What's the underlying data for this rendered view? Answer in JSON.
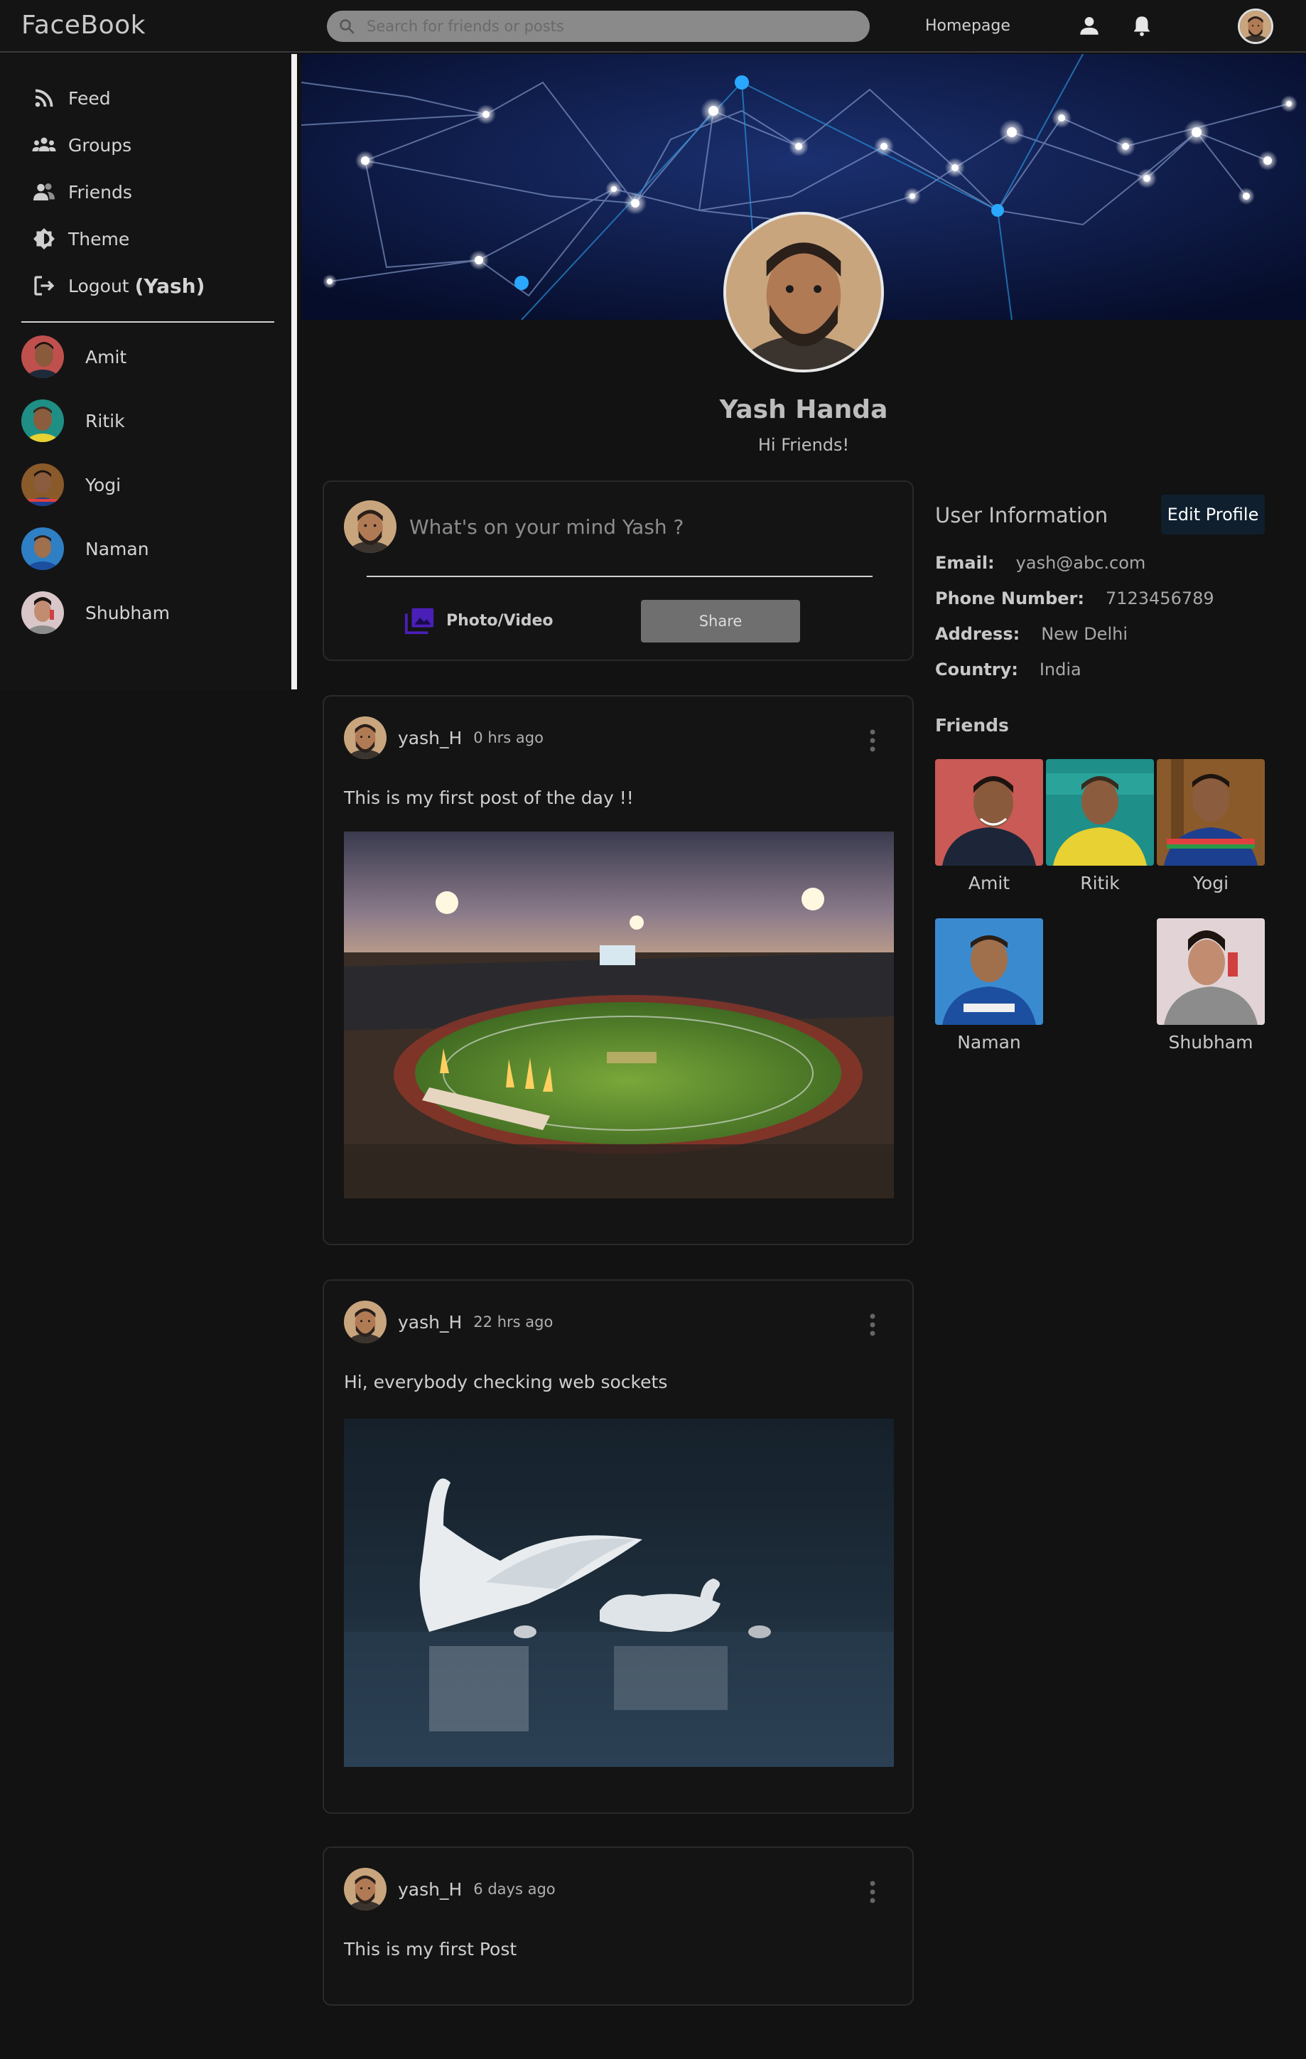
{
  "header": {
    "brand": "FaceBook",
    "search_placeholder": "Search for friends or posts",
    "homepage_link": "Homepage",
    "icons": [
      "person-icon",
      "bell-icon"
    ]
  },
  "sidebar": {
    "items": [
      {
        "label": "Feed",
        "icon": "rss-icon"
      },
      {
        "label": "Groups",
        "icon": "groups-icon"
      },
      {
        "label": "Friends",
        "icon": "friends-icon"
      },
      {
        "label": "Theme",
        "icon": "theme-icon"
      },
      {
        "label": "Logout",
        "icon": "logout-icon",
        "extra": "(Yash)"
      }
    ],
    "friends": [
      "Amit",
      "Ritik",
      "Yogi",
      "Naman",
      "Shubham"
    ]
  },
  "profile": {
    "name": "Yash Handa",
    "bio": "Hi Friends!"
  },
  "composer": {
    "placeholder": "What's on your mind Yash ?",
    "photo_label": "Photo/Video",
    "share_label": "Share"
  },
  "posts": [
    {
      "user": "yash_H",
      "time": "0 hrs ago",
      "text": "This is my first post of the day !!",
      "image": "stadium-photo"
    },
    {
      "user": "yash_H",
      "time": "22 hrs ago",
      "text": "Hi, everybody checking web sockets",
      "image": "swans-photo"
    },
    {
      "user": "yash_H",
      "time": "6 days ago",
      "text": "This is my first Post"
    }
  ],
  "user_info": {
    "title": "User Information",
    "edit_label": "Edit Profile",
    "fields": [
      {
        "key": "Email:",
        "value": "yash@abc.com"
      },
      {
        "key": "Phone Number:",
        "value": "7123456789"
      },
      {
        "key": "Address:",
        "value": "New Delhi"
      },
      {
        "key": "Country:",
        "value": "India"
      }
    ],
    "friends_title": "Friends",
    "friends": [
      "Amit",
      "Ritik",
      "Yogi",
      "Naman",
      "Shubham"
    ]
  },
  "colors": {
    "background": "#121212",
    "share_button": "#6f6f6f",
    "edit_button": "#0f1f2e",
    "photo_icon": "#4a1fb8"
  }
}
